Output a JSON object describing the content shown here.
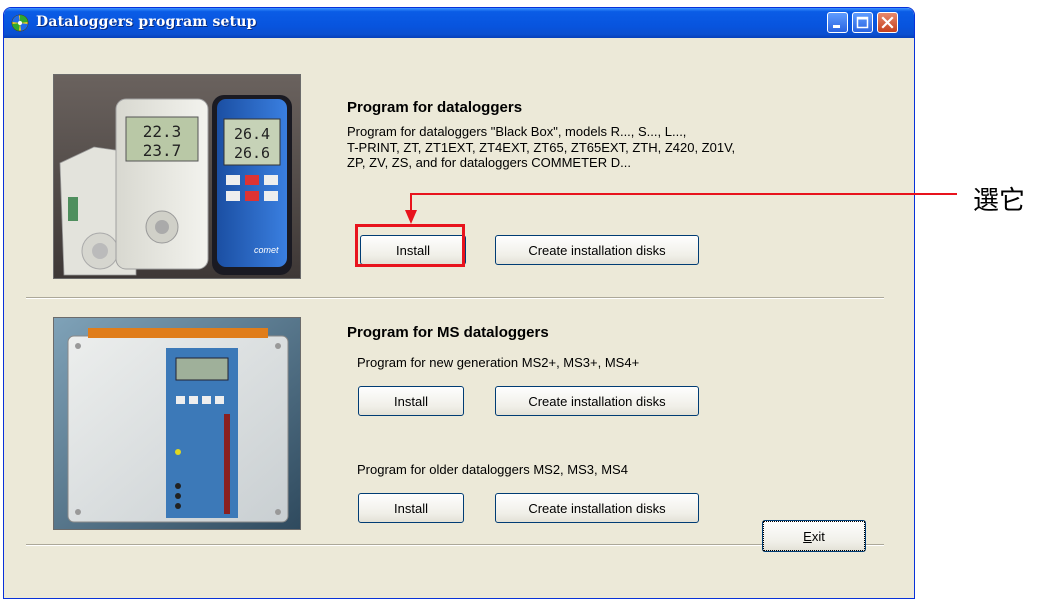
{
  "window": {
    "title": "Dataloggers program setup"
  },
  "section1": {
    "heading": "Program for dataloggers",
    "description": "Program for dataloggers \"Black Box\", models R..., S..., L...,\nT-PRINT, ZT, ZT1EXT, ZT4EXT, ZT65, ZT65EXT, ZTH, Z420, Z01V,\nZP, ZV, ZS, and for dataloggers COMMETER D...",
    "install_label": "Install",
    "disks_label": "Create installation disks",
    "device_readings": [
      "22.3",
      "23.7",
      "26.4",
      "26.6"
    ]
  },
  "section2": {
    "heading": "Program for MS dataloggers",
    "new_gen": {
      "description": "Program for new generation MS2+, MS3+, MS4+",
      "install_label": "Install",
      "disks_label": "Create installation disks"
    },
    "old_gen": {
      "description": "Program for older dataloggers MS2, MS3, MS4",
      "install_label": "Install",
      "disks_label": "Create installation disks"
    }
  },
  "exit": {
    "label_prefix": "",
    "label_mnemonic": "E",
    "label_rest": "xit"
  },
  "annotation": {
    "label": "選它",
    "color": "#e8131d"
  }
}
